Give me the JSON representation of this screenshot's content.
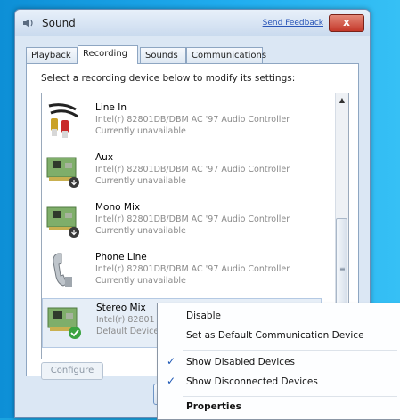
{
  "window": {
    "title": "Sound",
    "feedback_link": "Send Feedback",
    "close_label": "x"
  },
  "tabs": [
    "Playback",
    "Recording",
    "Sounds",
    "Communications"
  ],
  "active_tab": "Recording",
  "instruction": "Select a recording device below to modify its settings:",
  "devices": [
    {
      "name": "Line In",
      "driver": "Intel(r) 82801DB/DBM AC '97 Audio Controller",
      "status": "Currently unavailable",
      "icon": "line-in-icon"
    },
    {
      "name": "Aux",
      "driver": "Intel(r) 82801DB/DBM AC '97 Audio Controller",
      "status": "Currently unavailable",
      "icon": "sound-card-icon"
    },
    {
      "name": "Mono Mix",
      "driver": "Intel(r) 82801DB/DBM AC '97 Audio Controller",
      "status": "Currently unavailable",
      "icon": "sound-card-icon"
    },
    {
      "name": "Phone Line",
      "driver": "Intel(r) 82801DB/DBM AC '97 Audio Controller",
      "status": "Currently unavailable",
      "icon": "phone-icon"
    },
    {
      "name": "Stereo Mix",
      "driver": "Intel(r) 82801",
      "status": "Default Device",
      "icon": "sound-card-default-icon"
    }
  ],
  "configure_button": "Configure",
  "context_menu": {
    "disable": "Disable",
    "set_default_comm": "Set as Default Communication Device",
    "show_disabled": "Show Disabled Devices",
    "show_disconnected": "Show Disconnected Devices",
    "properties": "Properties",
    "check_glyph": "✓"
  },
  "colors": {
    "desktop": "#1aa3e0",
    "window": "#dbe7f4",
    "close": "#c4382a",
    "check": "#1e58b5"
  }
}
